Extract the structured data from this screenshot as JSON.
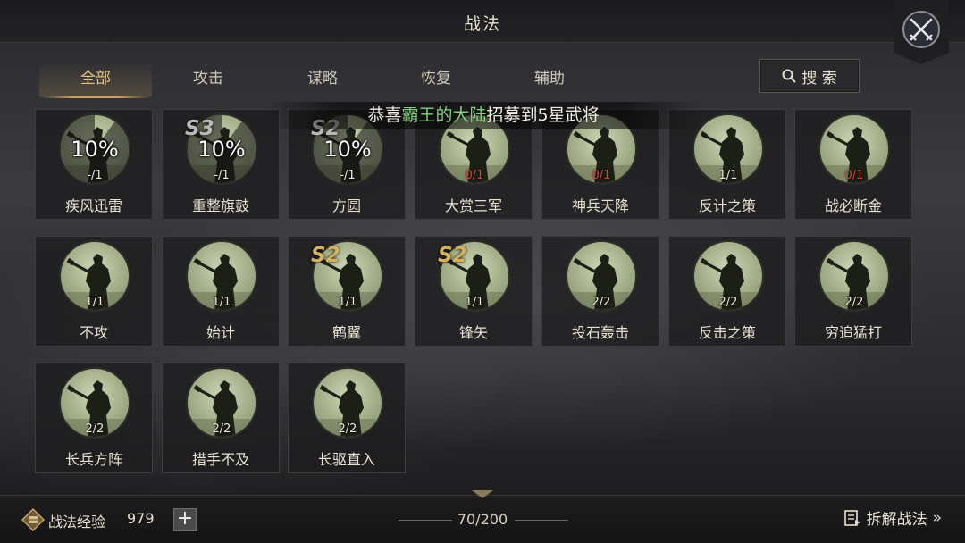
{
  "header": {
    "title": "战法"
  },
  "tabs": [
    {
      "label": "全部",
      "active": true
    },
    {
      "label": "攻击",
      "active": false
    },
    {
      "label": "谋略",
      "active": false
    },
    {
      "label": "恢复",
      "active": false
    },
    {
      "label": "辅助",
      "active": false
    }
  ],
  "search": {
    "label": "搜 索",
    "icon": "search-icon"
  },
  "banner": {
    "prefix": "恭喜",
    "player": "霸王的大陆",
    "suffix": "招募到5星武将"
  },
  "skills": [
    {
      "name": "疾风迅雷",
      "count": "-/1",
      "progress": "10%",
      "season": "",
      "count_color": "white"
    },
    {
      "name": "重整旗鼓",
      "count": "-/1",
      "progress": "10%",
      "season": "S3",
      "season_style": "grey",
      "count_color": "white"
    },
    {
      "name": "方圆",
      "count": "-/1",
      "progress": "10%",
      "season": "S2",
      "season_style": "grey",
      "count_color": "white"
    },
    {
      "name": "大赏三军",
      "count": "0/1",
      "progress": "",
      "season": "",
      "count_color": "red"
    },
    {
      "name": "神兵天降",
      "count": "0/1",
      "progress": "",
      "season": "",
      "count_color": "red"
    },
    {
      "name": "反计之策",
      "count": "1/1",
      "progress": "",
      "season": "",
      "count_color": "white"
    },
    {
      "name": "战必断金",
      "count": "0/1",
      "progress": "",
      "season": "",
      "count_color": "red"
    },
    {
      "name": "不攻",
      "count": "1/1",
      "progress": "",
      "season": "",
      "count_color": "white"
    },
    {
      "name": "始计",
      "count": "1/1",
      "progress": "",
      "season": "",
      "count_color": "white"
    },
    {
      "name": "鹤翼",
      "count": "1/1",
      "progress": "",
      "season": "S2",
      "season_style": "gold",
      "count_color": "white"
    },
    {
      "name": "锋矢",
      "count": "1/1",
      "progress": "",
      "season": "S2",
      "season_style": "gold",
      "count_color": "white"
    },
    {
      "name": "投石轰击",
      "count": "2/2",
      "progress": "",
      "season": "",
      "count_color": "white"
    },
    {
      "name": "反击之策",
      "count": "2/2",
      "progress": "",
      "season": "",
      "count_color": "white"
    },
    {
      "name": "穷追猛打",
      "count": "2/2",
      "progress": "",
      "season": "",
      "count_color": "white"
    },
    {
      "name": "长兵方阵",
      "count": "2/2",
      "progress": "",
      "season": "",
      "count_color": "white"
    },
    {
      "name": "措手不及",
      "count": "2/2",
      "progress": "",
      "season": "",
      "count_color": "white"
    },
    {
      "name": "长驱直入",
      "count": "2/2",
      "progress": "",
      "season": "",
      "count_color": "white"
    }
  ],
  "footer": {
    "exp_label": "战法经验",
    "exp_value": "979",
    "plus_label": "+",
    "capacity": "70/200",
    "dismantle_label": "拆解战法"
  },
  "colors": {
    "accent_gold": "#c9a066",
    "highlight_green": "#7fd27a",
    "count_red": "#d24a3a"
  }
}
